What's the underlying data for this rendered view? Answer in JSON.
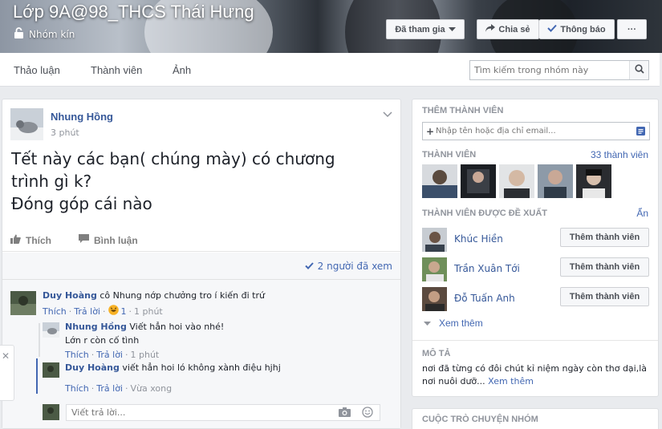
{
  "group": {
    "title": "Lớp 9A@98_THCS Thái Hưng",
    "privacy": "Nhóm kín"
  },
  "cover_buttons": {
    "joined": "Đã tham gia",
    "share": "Chia sẻ",
    "notifications": "Thông báo",
    "more": "···"
  },
  "nav": {
    "tabs": [
      "Thảo luận",
      "Thành viên",
      "Ảnh"
    ],
    "search_placeholder": "Tìm kiếm trong nhóm này"
  },
  "post": {
    "author": "Nhung Hồng",
    "time": "3 phút",
    "text_lines": [
      "Tết này các bạn( chúng mày) có chương",
      "trình gì k?",
      "Đóng góp cái nào"
    ],
    "like_label": "Thích",
    "comment_label": "Bình luận",
    "seen_by": "2 người đã xem",
    "comments": [
      {
        "author": "Duy Hoàng",
        "text": "cô Nhung nớp chưởng tro í kiến đi trứ",
        "like": "Thích",
        "reply": "Trả lời",
        "reaction_count": "1",
        "time": "1 phút",
        "replies": [
          {
            "author": "Nhung Hồng",
            "text": "Viết hẳn hoi vào nhé!",
            "text2": "Lớn r còn cố tình",
            "like": "Thích",
            "reply": "Trả lời",
            "time": "1 phút"
          },
          {
            "author": "Duy Hoàng",
            "text": "viết hẳn hoi ló không xành điệu hjhj",
            "like": "Thích",
            "reply": "Trả lời",
            "time": "Vừa xong"
          }
        ]
      }
    ],
    "reply_placeholder": "Viết trả lời..."
  },
  "sidebar": {
    "add_members": {
      "heading": "THÊM THÀNH VIÊN",
      "placeholder": "Nhập tên hoặc địa chỉ email..."
    },
    "members": {
      "heading": "THÀNH VIÊN",
      "count_link": "33 thành viên"
    },
    "suggested": {
      "heading": "THÀNH VIÊN ĐƯỢC ĐỀ XUẤT",
      "hide_link": "Ẩn",
      "people": [
        {
          "name": "Khúc Hiền",
          "button": "Thêm thành viên"
        },
        {
          "name": "Trần Xuân Tới",
          "button": "Thêm thành viên"
        },
        {
          "name": "Đỗ Tuấn Anh",
          "button": "Thêm thành viên"
        }
      ],
      "see_more": "Xem thêm"
    },
    "description": {
      "heading": "MÔ TẢ",
      "line1": "nơi đã từng có đôi chút kỉ niệm ngày còn thơ dại,là",
      "line2": "nơi nuôi dưỡ...",
      "see_more": "Xem thêm"
    },
    "chats": {
      "heading": "CUỘC TRÒ CHUYỆN NHÓM"
    }
  },
  "colors": {
    "link_blue": "#365899",
    "accent_blue": "#4267b2",
    "page_bg": "#e9ebee"
  }
}
